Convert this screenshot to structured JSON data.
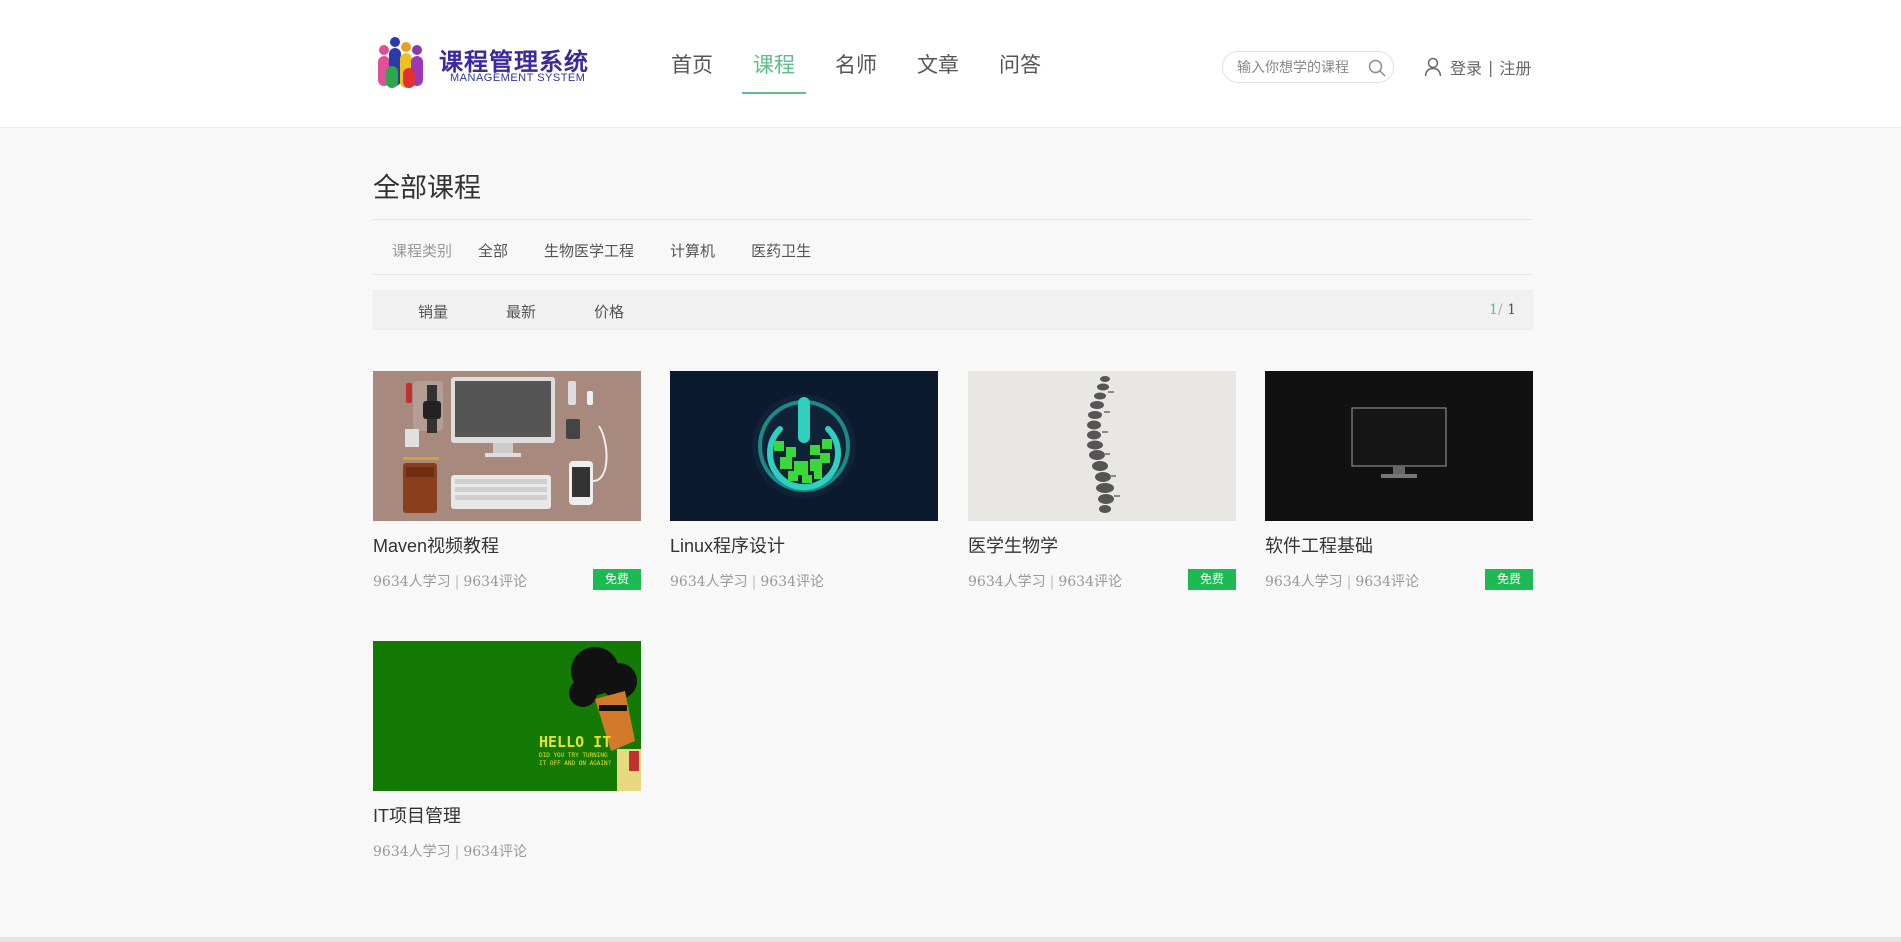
{
  "brand": {
    "title": "课程管理系统",
    "subtitle": "MANAGEMENT SYSTEM"
  },
  "nav": {
    "items": [
      {
        "label": "首页",
        "active": false
      },
      {
        "label": "课程",
        "active": true
      },
      {
        "label": "名师",
        "active": false
      },
      {
        "label": "文章",
        "active": false
      },
      {
        "label": "问答",
        "active": false
      }
    ],
    "accent_color": "#5cbf8a"
  },
  "search": {
    "placeholder": "输入你想学的课程",
    "icon": "search-icon"
  },
  "user": {
    "icon": "user-icon",
    "login": "登录",
    "separator": "|",
    "register": "注册"
  },
  "page": {
    "title": "全部课程"
  },
  "categories": {
    "label": "课程类别",
    "items": [
      "全部",
      "生物医学工程",
      "计算机",
      "医药卫生"
    ]
  },
  "sort": {
    "items": [
      "销量",
      "最新",
      "价格"
    ],
    "pager": {
      "current": "1",
      "slash": "/",
      "total": "1"
    }
  },
  "courses": [
    {
      "title": "Maven视频教程",
      "learners": "9634人学习",
      "sep": "|",
      "comments": "9634评论",
      "badge": "免费",
      "image": "desk-flatlay"
    },
    {
      "title": "Linux程序设计",
      "learners": "9634人学习",
      "sep": "|",
      "comments": "9634评论",
      "badge": "",
      "image": "power-button"
    },
    {
      "title": "医学生物学",
      "learners": "9634人学习",
      "sep": "|",
      "comments": "9634评论",
      "badge": "免费",
      "image": "spine"
    },
    {
      "title": "软件工程基础",
      "learners": "9634人学习",
      "sep": "|",
      "comments": "9634评论",
      "badge": "免费",
      "image": "monitor"
    },
    {
      "title": "IT项目管理",
      "learners": "9634人学习",
      "sep": "|",
      "comments": "9634评论",
      "badge": "",
      "image": "hello-it"
    }
  ],
  "thumb_text": {
    "hello": "HELLO IT",
    "line1": "DID YOU TRY TURNING",
    "line2": "IT OFF AND ON AGAIN?"
  },
  "colors": {
    "free_badge": "#1dba53",
    "background": "#f8f8f8"
  }
}
